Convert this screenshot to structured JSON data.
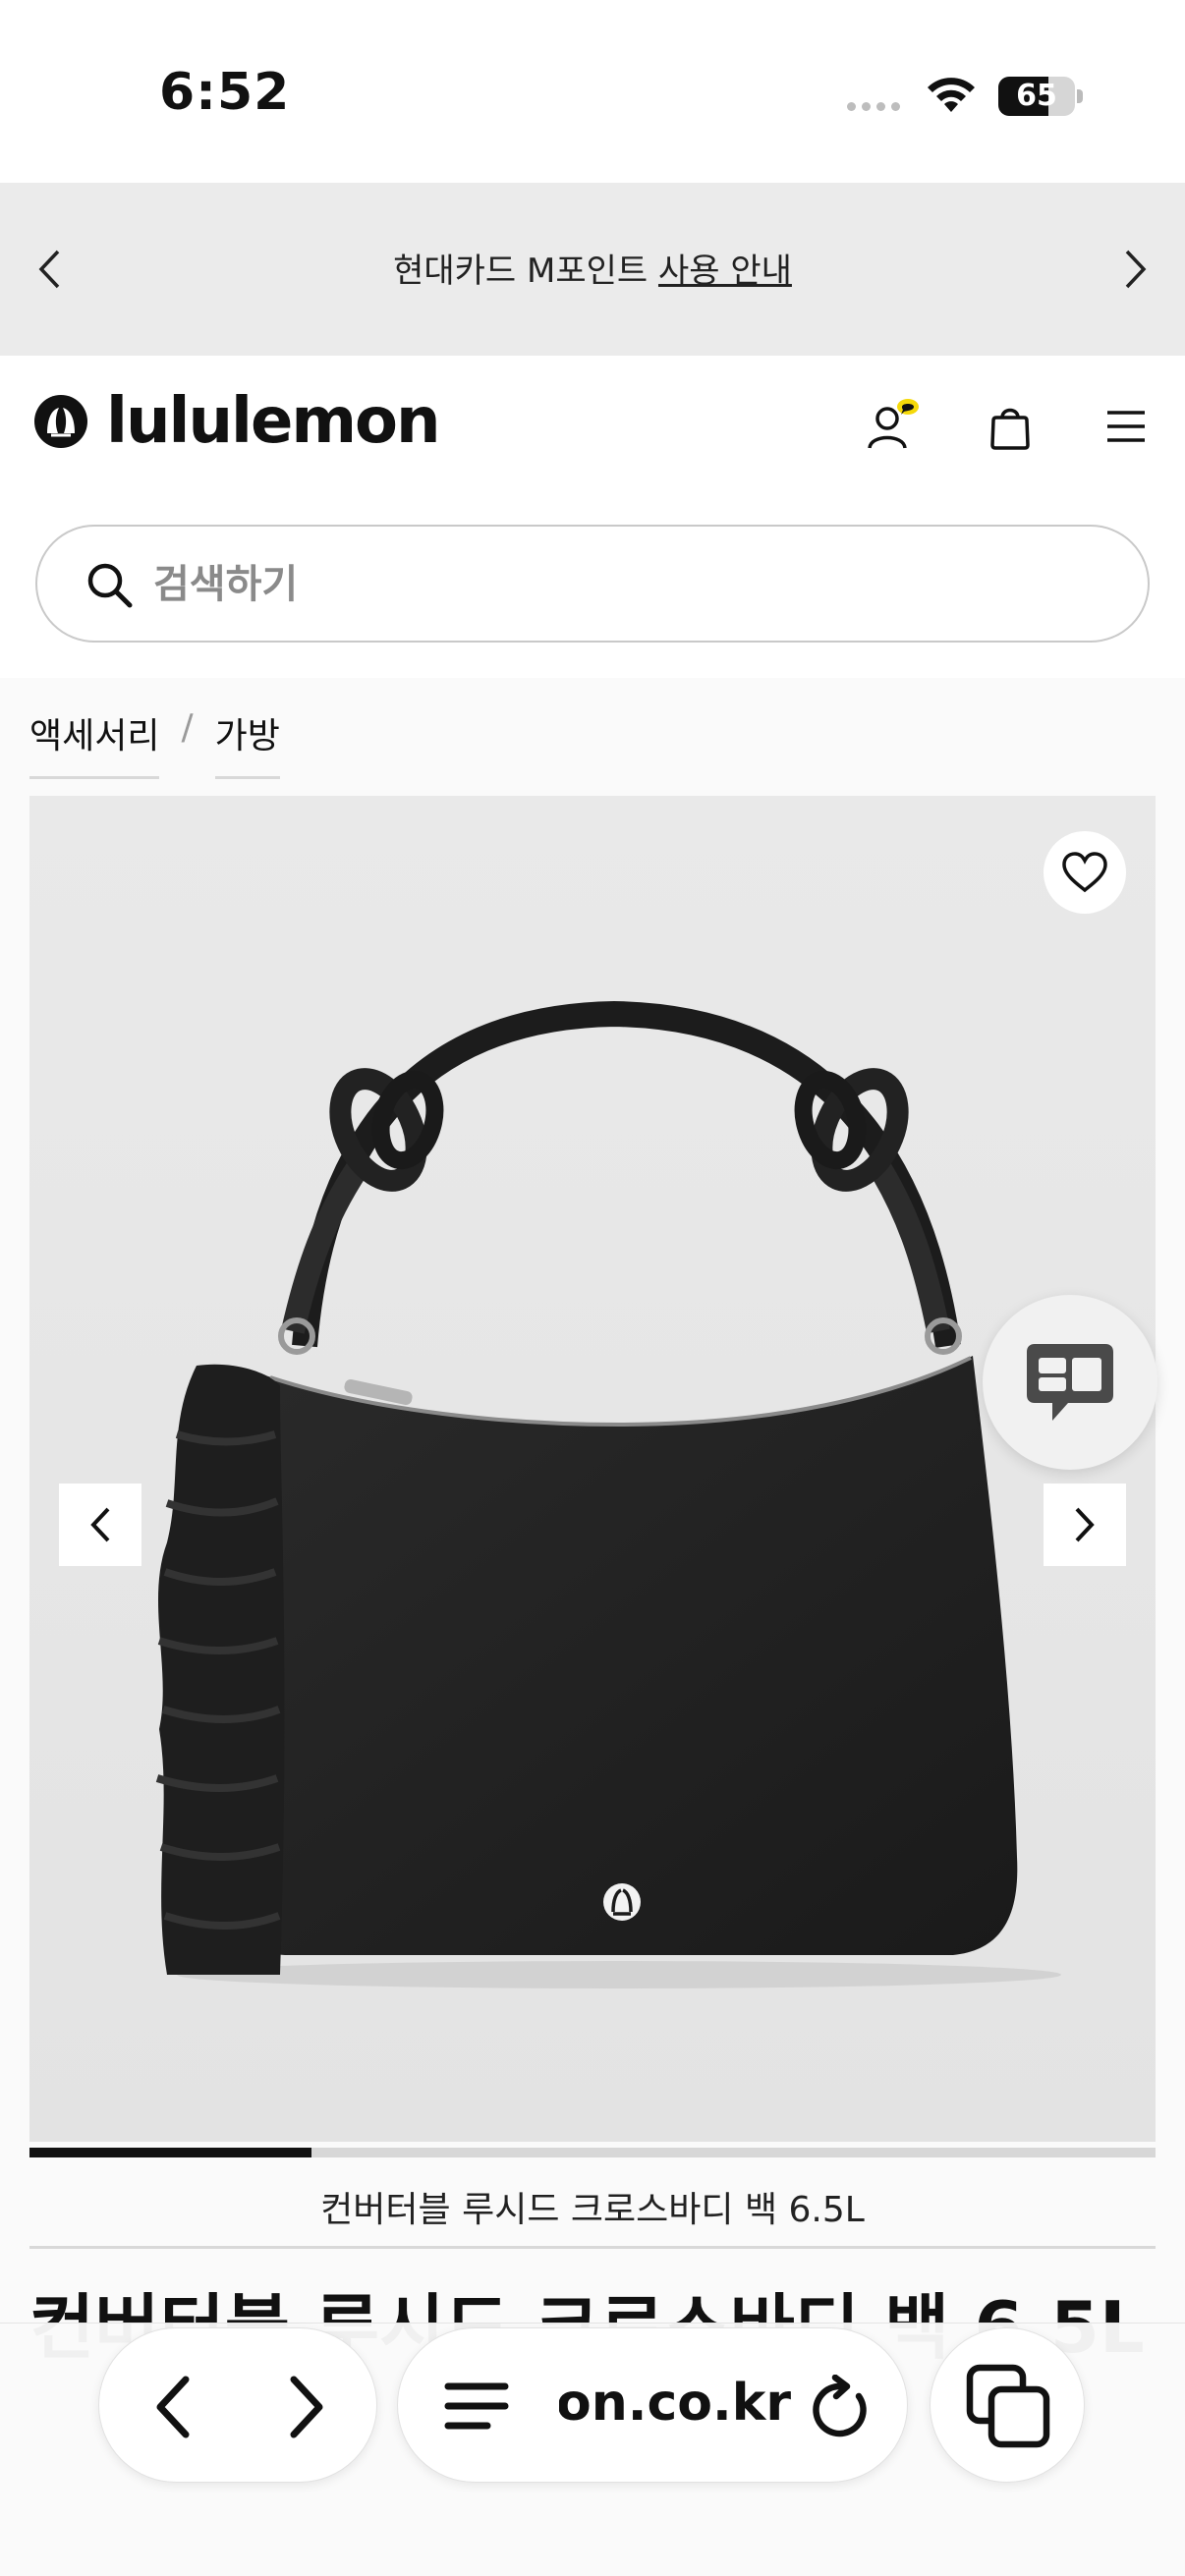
{
  "status_bar": {
    "time": "6:52",
    "battery_level": "65",
    "battery_fraction": 0.65,
    "icons": [
      "cellular-dots-icon",
      "wifi-icon",
      "battery-icon"
    ]
  },
  "promo_banner": {
    "text_prefix": "현대카드 M포인트 ",
    "link_text": "사용 안내",
    "prev_icon": "chevron-left-icon",
    "next_icon": "chevron-right-icon",
    "background": "#ebebeb"
  },
  "header": {
    "brand": "lululemon",
    "icons": [
      "account-icon",
      "shopping-bag-icon",
      "menu-icon"
    ],
    "account_badge_color": "#f5d90a"
  },
  "search": {
    "placeholder": "검색하기",
    "value": ""
  },
  "breadcrumb": {
    "items": [
      "액세서리",
      "가방"
    ],
    "separator": "/"
  },
  "gallery": {
    "slide_fraction": 0.25,
    "favorite_icon": "heart-icon",
    "prev_icon": "chevron-left-icon",
    "next_icon": "chevron-right-icon",
    "chat_icon": "chat-icon",
    "bag_logo_icon": "lululemon-logo-icon"
  },
  "product": {
    "caption": "컨버터블 루시드 크로스바디 백 6.5L",
    "title": "컨버터블 루시드 크로스바디 백 6.5L"
  },
  "browser_bar": {
    "url": "lululemon.co.kr",
    "icons": [
      "back-icon",
      "forward-icon",
      "page-menu-icon",
      "reload-icon",
      "tabs-icon"
    ]
  }
}
